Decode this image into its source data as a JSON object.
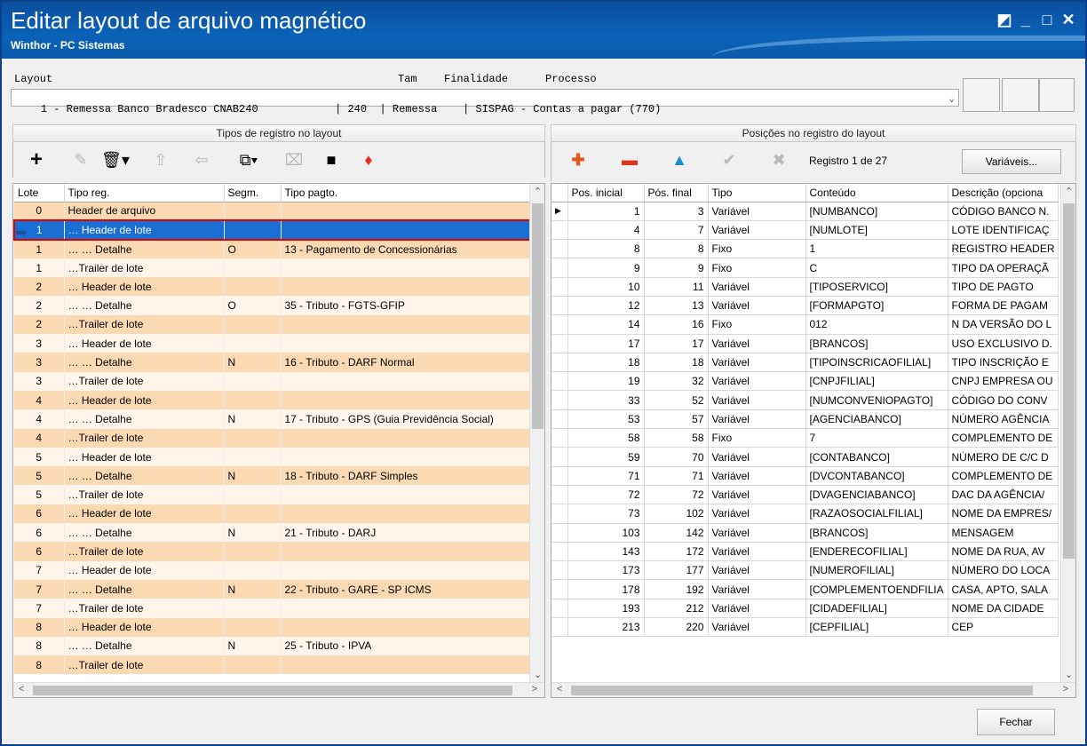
{
  "window": {
    "title": "Editar layout de arquivo magnético",
    "subtitle": "Winthor - PC Sistemas",
    "controls": [
      "◩",
      "_",
      "□",
      "✕"
    ]
  },
  "layout_header": {
    "labels": {
      "layout": "Layout",
      "tam": "Tam",
      "finalidade": "Finalidade",
      "processo": "Processo"
    },
    "selected_value": "1 - Remessa Banco Bradesco CNAB240            | 240  | Remessa    | SISPAG - Contas a pagar (770)"
  },
  "left_panel": {
    "title": "Tipos de registro no layout",
    "toolbar_icons": [
      "add-icon",
      "edit-icon",
      "delete-icon",
      "move-up-icon",
      "move-left-icon",
      "copy-icon",
      "paste-icon",
      "doc-icon",
      "warning-icon"
    ],
    "columns": [
      "Lote",
      "Tipo reg.",
      "Segm.",
      "Tipo pagto."
    ],
    "selected_index": 1,
    "rows": [
      {
        "lote": "0",
        "tipo": "Header de arquivo",
        "segm": "",
        "pagto": ""
      },
      {
        "lote": "1",
        "tipo": "… Header de lote",
        "segm": "",
        "pagto": ""
      },
      {
        "lote": "1",
        "tipo": "… … Detalhe",
        "segm": "O",
        "pagto": "13 - Pagamento de Concessionárias"
      },
      {
        "lote": "1",
        "tipo": "…Trailer de lote",
        "segm": "",
        "pagto": ""
      },
      {
        "lote": "2",
        "tipo": "… Header de lote",
        "segm": "",
        "pagto": ""
      },
      {
        "lote": "2",
        "tipo": "… … Detalhe",
        "segm": "O",
        "pagto": "35 - Tributo - FGTS-GFIP"
      },
      {
        "lote": "2",
        "tipo": "…Trailer de lote",
        "segm": "",
        "pagto": ""
      },
      {
        "lote": "3",
        "tipo": "… Header de lote",
        "segm": "",
        "pagto": ""
      },
      {
        "lote": "3",
        "tipo": "… … Detalhe",
        "segm": "N",
        "pagto": "16 - Tributo - DARF Normal"
      },
      {
        "lote": "3",
        "tipo": "…Trailer de lote",
        "segm": "",
        "pagto": ""
      },
      {
        "lote": "4",
        "tipo": "… Header de lote",
        "segm": "",
        "pagto": ""
      },
      {
        "lote": "4",
        "tipo": "… … Detalhe",
        "segm": "N",
        "pagto": "17 - Tributo - GPS (Guia Previdência Social)"
      },
      {
        "lote": "4",
        "tipo": "…Trailer de lote",
        "segm": "",
        "pagto": ""
      },
      {
        "lote": "5",
        "tipo": "… Header de lote",
        "segm": "",
        "pagto": ""
      },
      {
        "lote": "5",
        "tipo": "… … Detalhe",
        "segm": "N",
        "pagto": "18 - Tributo - DARF Simples"
      },
      {
        "lote": "5",
        "tipo": "…Trailer de lote",
        "segm": "",
        "pagto": ""
      },
      {
        "lote": "6",
        "tipo": "… Header de lote",
        "segm": "",
        "pagto": ""
      },
      {
        "lote": "6",
        "tipo": "… … Detalhe",
        "segm": "N",
        "pagto": "21 - Tributo - DARJ"
      },
      {
        "lote": "6",
        "tipo": "…Trailer de lote",
        "segm": "",
        "pagto": ""
      },
      {
        "lote": "7",
        "tipo": "… Header de lote",
        "segm": "",
        "pagto": ""
      },
      {
        "lote": "7",
        "tipo": "… … Detalhe",
        "segm": "N",
        "pagto": "22 - Tributo - GARE - SP ICMS"
      },
      {
        "lote": "7",
        "tipo": "…Trailer de lote",
        "segm": "",
        "pagto": ""
      },
      {
        "lote": "8",
        "tipo": "… Header de lote",
        "segm": "",
        "pagto": ""
      },
      {
        "lote": "8",
        "tipo": "… … Detalhe",
        "segm": "N",
        "pagto": "25 - Tributo - IPVA"
      },
      {
        "lote": "8",
        "tipo": "…Trailer de lote",
        "segm": "",
        "pagto": ""
      }
    ]
  },
  "right_panel": {
    "title": "Posições no registro do layout",
    "record_counter": "Registro 1 de 27",
    "variables_button": "Variáveis...",
    "columns": [
      "Pos. inicial",
      "Pós. final",
      "Tipo",
      "Conteúdo",
      "Descrição (opciona"
    ],
    "rows": [
      {
        "ini": "1",
        "fim": "3",
        "tipo": "Variável",
        "conteudo": "[NUMBANCO]",
        "desc": "CÓDIGO BANCO N."
      },
      {
        "ini": "4",
        "fim": "7",
        "tipo": "Variável",
        "conteudo": "[NUMLOTE]",
        "desc": "LOTE IDENTIFICAÇ"
      },
      {
        "ini": "8",
        "fim": "8",
        "tipo": "Fixo",
        "conteudo": "1",
        "desc": "REGISTRO HEADER"
      },
      {
        "ini": "9",
        "fim": "9",
        "tipo": "Fixo",
        "conteudo": "C",
        "desc": "TIPO DA OPERAÇÃ"
      },
      {
        "ini": "10",
        "fim": "11",
        "tipo": "Variável",
        "conteudo": "[TIPOSERVICO]",
        "desc": "TIPO DE PAGTO"
      },
      {
        "ini": "12",
        "fim": "13",
        "tipo": "Variável",
        "conteudo": "[FORMAPGTO]",
        "desc": "FORMA DE PAGAM"
      },
      {
        "ini": "14",
        "fim": "16",
        "tipo": "Fixo",
        "conteudo": "012",
        "desc": "N DA VERSÃO DO L"
      },
      {
        "ini": "17",
        "fim": "17",
        "tipo": "Variável",
        "conteudo": "[BRANCOS]",
        "desc": "USO EXCLUSIVO D."
      },
      {
        "ini": "18",
        "fim": "18",
        "tipo": "Variável",
        "conteudo": "[TIPOINSCRICAOFILIAL]",
        "desc": "TIPO INSCRIÇÃO E"
      },
      {
        "ini": "19",
        "fim": "32",
        "tipo": "Variável",
        "conteudo": "[CNPJFILIAL]",
        "desc": "CNPJ EMPRESA OU"
      },
      {
        "ini": "33",
        "fim": "52",
        "tipo": "Variável",
        "conteudo": "[NUMCONVENIOPAGTO]",
        "desc": "CÓDIGO DO CONV"
      },
      {
        "ini": "53",
        "fim": "57",
        "tipo": "Variável",
        "conteudo": "[AGENCIABANCO]",
        "desc": "NÚMERO AGÊNCIA"
      },
      {
        "ini": "58",
        "fim": "58",
        "tipo": "Fixo",
        "conteudo": "7",
        "desc": "COMPLEMENTO DE"
      },
      {
        "ini": "59",
        "fim": "70",
        "tipo": "Variável",
        "conteudo": "[CONTABANCO]",
        "desc": "NÚMERO DE C/C D"
      },
      {
        "ini": "71",
        "fim": "71",
        "tipo": "Variável",
        "conteudo": "[DVCONTABANCO]",
        "desc": "COMPLEMENTO DE"
      },
      {
        "ini": "72",
        "fim": "72",
        "tipo": "Variável",
        "conteudo": "[DVAGENCIABANCO]",
        "desc": "DAC DA AGÊNCIA/"
      },
      {
        "ini": "73",
        "fim": "102",
        "tipo": "Variável",
        "conteudo": "[RAZAOSOCIALFILIAL]",
        "desc": "NOME DA EMPRES/"
      },
      {
        "ini": "103",
        "fim": "142",
        "tipo": "Variável",
        "conteudo": "[BRANCOS]",
        "desc": "MENSAGEM"
      },
      {
        "ini": "143",
        "fim": "172",
        "tipo": "Variável",
        "conteudo": "[ENDERECOFILIAL]",
        "desc": "NOME DA RUA, AV"
      },
      {
        "ini": "173",
        "fim": "177",
        "tipo": "Variável",
        "conteudo": "[NUMEROFILIAL]",
        "desc": "NÚMERO DO LOCA"
      },
      {
        "ini": "178",
        "fim": "192",
        "tipo": "Variável",
        "conteudo": "[COMPLEMENTOENDFILIA",
        "desc": "CASA, APTO, SALA"
      },
      {
        "ini": "193",
        "fim": "212",
        "tipo": "Variável",
        "conteudo": "[CIDADEFILIAL]",
        "desc": "NOME DA CIDADE"
      },
      {
        "ini": "213",
        "fim": "220",
        "tipo": "Variável",
        "conteudo": "[CEPFILIAL]",
        "desc": "CEP"
      }
    ]
  },
  "footer": {
    "close_button": "Fechar"
  }
}
